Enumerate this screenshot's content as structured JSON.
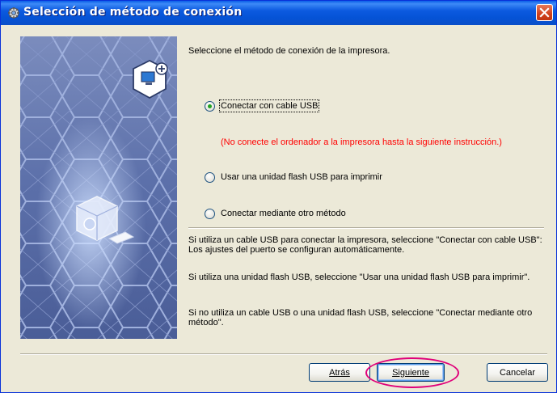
{
  "window": {
    "title": "Selección de método de conexión",
    "title_icon": "installer-gear-icon",
    "close_icon": "close-icon"
  },
  "art": {
    "description_icon": "connection-cube-icon",
    "badge_icon": "computer-add-icon"
  },
  "content": {
    "intro": "Seleccione el método de conexión de la impresora.",
    "options": [
      {
        "label": "Conectar con cable USB",
        "selected": true
      },
      {
        "label": "Usar una unidad flash USB para imprimir",
        "selected": false
      },
      {
        "label": "Conectar mediante otro método",
        "selected": false
      }
    ],
    "warning": "(No conecte el ordenador a la impresora hasta la siguiente instrucción.)",
    "help": [
      "Si utiliza un cable USB para conectar la impresora, seleccione \"Conectar con cable USB\": Los ajustes del puerto se configuran automáticamente.",
      "Si utiliza una unidad flash USB, seleccione \"Usar una unidad flash USB para imprimir\".",
      "Si no utiliza un cable USB o una unidad flash USB, seleccione \"Conectar mediante otro método\"."
    ]
  },
  "buttons": {
    "back": "Atrás",
    "next": "Siguiente",
    "cancel": "Cancelar"
  },
  "colors": {
    "title_bar": "#0553d6",
    "warning": "#ff0000",
    "highlight_ring": "#e0007a",
    "art_background": "#5b6fa9"
  }
}
